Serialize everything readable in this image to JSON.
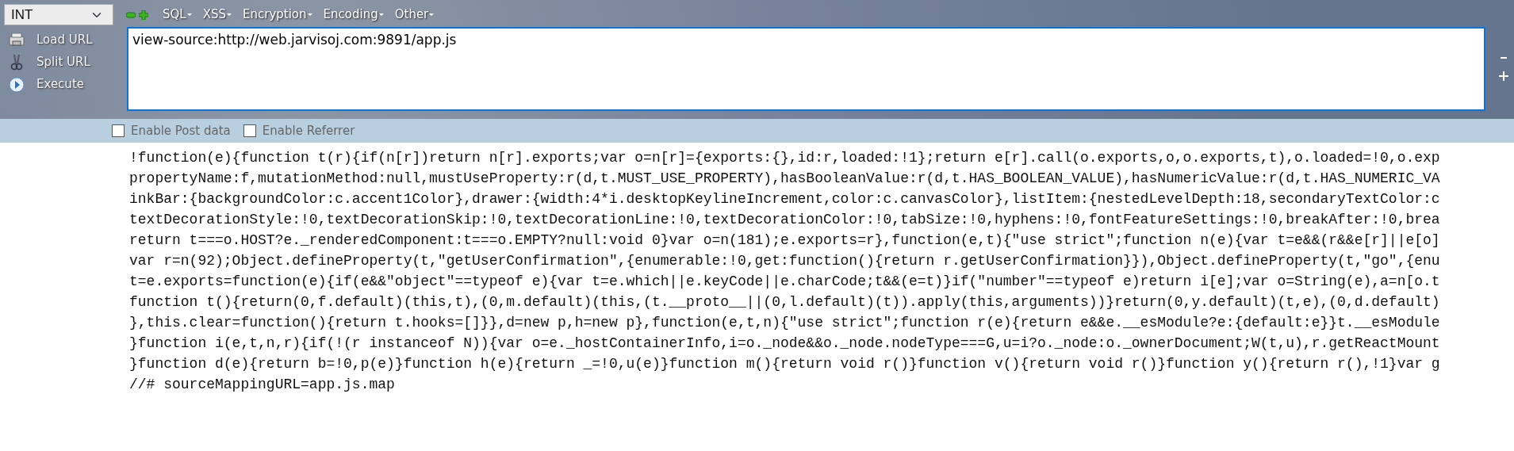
{
  "mode_select": {
    "value": "INT"
  },
  "menus": [
    {
      "label": "SQL"
    },
    {
      "label": "XSS"
    },
    {
      "label": "Encryption"
    },
    {
      "label": "Encoding"
    },
    {
      "label": "Other"
    }
  ],
  "actions": [
    {
      "kind": "load",
      "label": "Load URL"
    },
    {
      "kind": "split",
      "label": "Split URL"
    },
    {
      "kind": "execute",
      "label": "Execute"
    }
  ],
  "url_field": {
    "value": "view-source:http://web.jarvisoj.com:9891/app.js"
  },
  "options": [
    {
      "label": "Enable Post data",
      "checked": false
    },
    {
      "label": "Enable Referrer",
      "checked": false
    }
  ],
  "source_lines": [
    "!function(e){function t(r){if(n[r])return n[r].exports;var o=n[r]={exports:{},id:r,loaded:!1};return e[r].call(o.exports,o,o.exports,t),o.loaded=!0,o.exp",
    "propertyName:f,mutationMethod:null,mustUseProperty:r(d,t.MUST_USE_PROPERTY),hasBooleanValue:r(d,t.HAS_BOOLEAN_VALUE),hasNumericValue:r(d,t.HAS_NUMERIC_VA",
    "inkBar:{backgroundColor:c.accent1Color},drawer:{width:4*i.desktopKeylineIncrement,color:c.canvasColor},listItem:{nestedLevelDepth:18,secondaryTextColor:c",
    "textDecorationStyle:!0,textDecorationSkip:!0,textDecorationLine:!0,textDecorationColor:!0,tabSize:!0,hyphens:!0,fontFeatureSettings:!0,breakAfter:!0,brea",
    "return t===o.HOST?e._renderedComponent:t===o.EMPTY?null:void 0}var o=n(181);e.exports=r},function(e,t){\"use strict\";function n(e){var t=e&&(r&&e[r]||e[o]",
    "var r=n(92);Object.defineProperty(t,\"getUserConfirmation\",{enumerable:!0,get:function(){return r.getUserConfirmation}}),Object.defineProperty(t,\"go\",{enu",
    "t=e.exports=function(e){if(e&&\"object\"==typeof e){var t=e.which||e.keyCode||e.charCode;t&&(e=t)}if(\"number\"==typeof e)return i[e];var o=String(e),a=n[o.t",
    "function t(){return(0,f.default)(this,t),(0,m.default)(this,(t.__proto__||(0,l.default)(t)).apply(this,arguments))}return(0,y.default)(t,e),(0,d.default)",
    "},this.clear=function(){return t.hooks=[]}},d=new p,h=new p},function(e,t,n){\"use strict\";function r(e){return e&&e.__esModule?e:{default:e}}t.__esModule",
    "}function i(e,t,n,r){if(!(r instanceof N)){var o=e._hostContainerInfo,i=o._node&&o._node.nodeType===G,u=i?o._node:o._ownerDocument;W(t,u),r.getReactMount",
    "}function d(e){return b=!0,p(e)}function h(e){return _=!0,u(e)}function m(){return void r()}function v(){return void r()}function y(){return r(),!1}var g",
    "//# sourceMappingURL=app.js.map"
  ]
}
